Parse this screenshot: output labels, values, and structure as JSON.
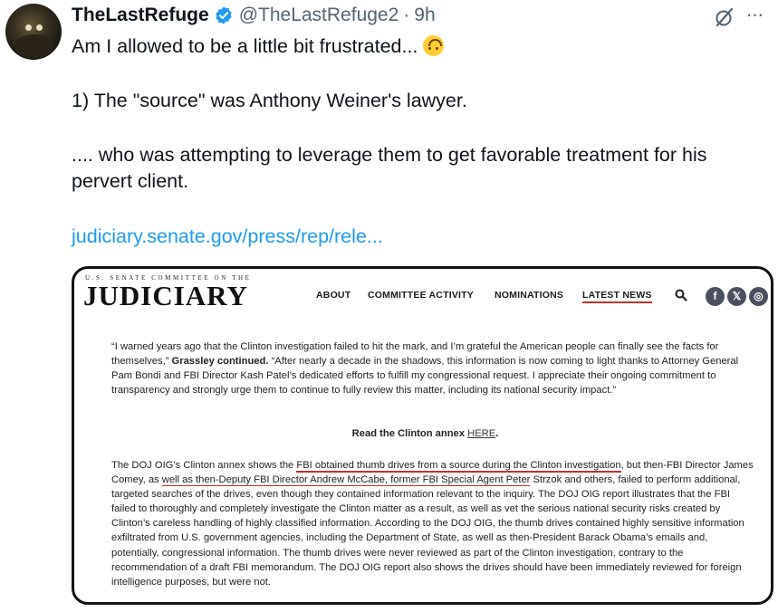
{
  "tweet": {
    "display_name": "TheLastRefuge",
    "handle": "@TheLastRefuge2",
    "separator": "·",
    "time": "9h",
    "more_label": "···",
    "line1": "Am I allowed to be a little bit frustrated...",
    "line2": "1) The \"source\" was Anthony Weiner's lawyer.",
    "line3": ".... who was attempting to leverage them to get favorable treatment for his pervert client.",
    "link": "judiciary.senate.gov/press/rep/rele..."
  },
  "screenshot": {
    "committee_label": "U.S. SENATE COMMITTEE ON THE",
    "logo": "JUDICIARY",
    "nav": [
      "ABOUT",
      "COMMITTEE ACTIVITY",
      "NOMINATIONS",
      "LATEST NEWS"
    ],
    "social": [
      "f",
      "𝕏",
      "◎"
    ],
    "quote_part1": "“I warned years ago that the Clinton investigation failed to hit the mark, and I’m grateful the American people can finally see the facts for themselves,”",
    "quote_bold": "Grassley continued.",
    "quote_part2": "“After nearly a decade in the shadows, this information is now coming to light thanks to Attorney General Pam Bondi and FBI Director Kash Patel’s dedicated efforts to fulfill my congressional request. I appreciate their ongoing commitment to transparency and strongly urge them to continue to fully review this matter, including its national security impact.”",
    "read_text": "Read the Clinton annex",
    "read_link": "HERE",
    "read_end": ".",
    "body_a": "The DOJ OIG’s Clinton annex shows the",
    "body_hl1": "FBI obtained thumb drives from a source during the Clinton investigation",
    "body_b": ", but then-FBI Director James Comey, as",
    "body_hl2": "well as then-Deputy FBI Director Andrew McCabe, former FBI Special Agent Peter",
    "body_c": "Strzok and others, failed to perform additional, targeted searches of the drives, even though they contained information relevant to the inquiry. The DOJ OIG report illustrates that the FBI failed to thoroughly and completely investigate the Clinton matter as a result, as well as vet the serious national security risks created by Clinton’s careless handling of highly classified information. According to the DOJ OIG, the thumb drives contained highly sensitive information exfiltrated from U.S. government agencies, including the Department of State, as well as then-President Barack Obama’s emails and, potentially, congressional information. The thumb drives were never reviewed as part of the Clinton investigation, contrary to the recommendation of a draft FBI memorandum. The DOJ OIG report also shows the drives should have been immediately reviewed for foreign intelligence purposes, but were not."
  },
  "colors": {
    "link": "#1d9bf0",
    "verified": "#1d9bf0",
    "muted": "#536471",
    "underline": "#c03030"
  }
}
